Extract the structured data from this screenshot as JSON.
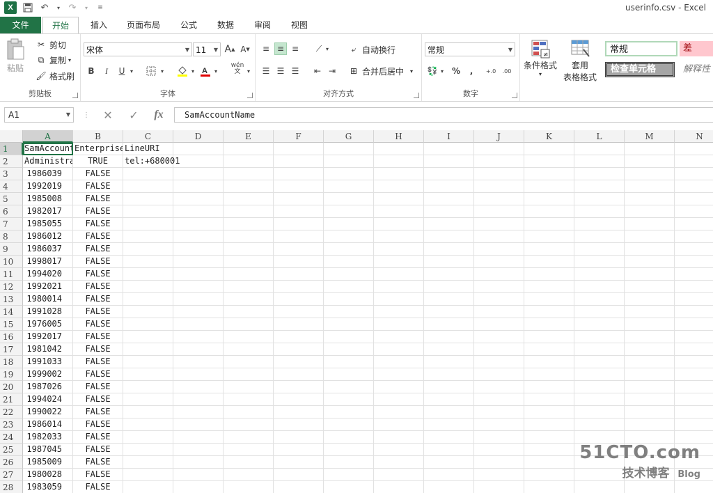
{
  "window": {
    "title": "userinfo.csv - Excel"
  },
  "qat": {
    "logo": "X",
    "save_icon": "save-icon",
    "undo_icon": "undo-icon",
    "redo_icon": "redo-icon",
    "customize_icon": "customize-icon"
  },
  "tabs": [
    "文件",
    "开始",
    "插入",
    "页面布局",
    "公式",
    "数据",
    "审阅",
    "视图"
  ],
  "ribbon": {
    "clipboard": {
      "label": "剪贴板",
      "paste": "粘贴",
      "cut": "剪切",
      "copy": "复制",
      "format_painter": "格式刷"
    },
    "font": {
      "label": "字体",
      "font_name": "宋体",
      "font_size": "11",
      "bold": "B",
      "italic": "I",
      "underline": "U",
      "grow": "A",
      "shrink": "A",
      "wen": "wén"
    },
    "alignment": {
      "label": "对齐方式",
      "wrap_text": "自动换行",
      "merge_center": "合并后居中"
    },
    "number": {
      "label": "数字",
      "format": "常规",
      "percent": "%",
      "comma": ","
    },
    "styles": {
      "conditional_format": "条件格式",
      "table_format_1": "套用",
      "table_format_2": "表格格式",
      "normal": "常规",
      "bad": "差",
      "check_cell": "检查单元格",
      "explanatory": "解释性"
    }
  },
  "formula_bar": {
    "name_box": "A1",
    "fx": "fx",
    "content": "SamAccountName"
  },
  "sheet": {
    "columns": [
      "A",
      "B",
      "C",
      "D",
      "E",
      "F",
      "G",
      "H",
      "I",
      "J",
      "K",
      "L",
      "M",
      "N"
    ],
    "rows": [
      {
        "n": "1",
        "a": "SamAccountName",
        "b": "EnterpriseVoiceEnabled",
        "c": "LineURI"
      },
      {
        "n": "2",
        "a": "Administrator",
        "b": "TRUE",
        "c": "tel:+680001"
      },
      {
        "n": "3",
        "a": "1986039",
        "b": "FALSE",
        "c": ""
      },
      {
        "n": "4",
        "a": "1992019",
        "b": "FALSE",
        "c": ""
      },
      {
        "n": "5",
        "a": "1985008",
        "b": "FALSE",
        "c": ""
      },
      {
        "n": "6",
        "a": "1982017",
        "b": "FALSE",
        "c": ""
      },
      {
        "n": "7",
        "a": "1985055",
        "b": "FALSE",
        "c": ""
      },
      {
        "n": "8",
        "a": "1986012",
        "b": "FALSE",
        "c": ""
      },
      {
        "n": "9",
        "a": "1986037",
        "b": "FALSE",
        "c": ""
      },
      {
        "n": "10",
        "a": "1998017",
        "b": "FALSE",
        "c": ""
      },
      {
        "n": "11",
        "a": "1994020",
        "b": "FALSE",
        "c": ""
      },
      {
        "n": "12",
        "a": "1992021",
        "b": "FALSE",
        "c": ""
      },
      {
        "n": "13",
        "a": "1980014",
        "b": "FALSE",
        "c": ""
      },
      {
        "n": "14",
        "a": "1991028",
        "b": "FALSE",
        "c": ""
      },
      {
        "n": "15",
        "a": "1976005",
        "b": "FALSE",
        "c": ""
      },
      {
        "n": "16",
        "a": "1992017",
        "b": "FALSE",
        "c": ""
      },
      {
        "n": "17",
        "a": "1981042",
        "b": "FALSE",
        "c": ""
      },
      {
        "n": "18",
        "a": "1991033",
        "b": "FALSE",
        "c": ""
      },
      {
        "n": "19",
        "a": "1999002",
        "b": "FALSE",
        "c": ""
      },
      {
        "n": "20",
        "a": "1987026",
        "b": "FALSE",
        "c": ""
      },
      {
        "n": "21",
        "a": "1994024",
        "b": "FALSE",
        "c": ""
      },
      {
        "n": "22",
        "a": "1990022",
        "b": "FALSE",
        "c": ""
      },
      {
        "n": "23",
        "a": "1986014",
        "b": "FALSE",
        "c": ""
      },
      {
        "n": "24",
        "a": "1982033",
        "b": "FALSE",
        "c": ""
      },
      {
        "n": "25",
        "a": "1987045",
        "b": "FALSE",
        "c": ""
      },
      {
        "n": "26",
        "a": "1985009",
        "b": "FALSE",
        "c": ""
      },
      {
        "n": "27",
        "a": "1980028",
        "b": "FALSE",
        "c": ""
      },
      {
        "n": "28",
        "a": "1983059",
        "b": "FALSE",
        "c": ""
      }
    ]
  },
  "watermark": {
    "top": "51CTO.com",
    "bottom_cn": "技术博客",
    "bottom_en": "Blog"
  }
}
